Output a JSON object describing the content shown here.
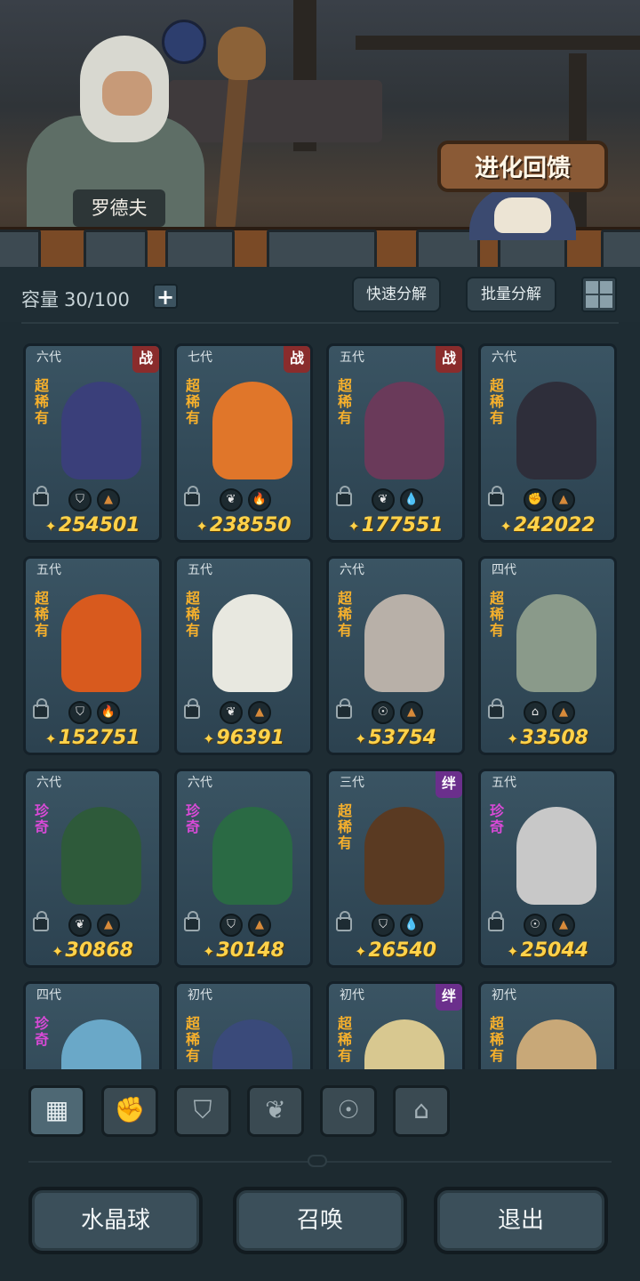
{
  "scene": {
    "npc_name": "罗德夫",
    "evolution_banner": "进化回馈"
  },
  "toolbar": {
    "capacity_label": "容量",
    "capacity_value": "30/100",
    "quick_decompose": "快速分解",
    "batch_decompose": "批量分解"
  },
  "cards": [
    {
      "gen": "六代",
      "tag": "战",
      "rarity": "超稀有",
      "power": "254501",
      "monster_color": "#3a3f7a",
      "badges": [
        "shield-icon",
        "earth-icon"
      ]
    },
    {
      "gen": "七代",
      "tag": "战",
      "rarity": "超稀有",
      "power": "238550",
      "monster_color": "#e0762a",
      "badges": [
        "leaf-icon",
        "fire-icon"
      ]
    },
    {
      "gen": "五代",
      "tag": "战",
      "rarity": "超稀有",
      "power": "177551",
      "monster_color": "#6a3a5a",
      "badges": [
        "leaf-icon",
        "water-icon"
      ]
    },
    {
      "gen": "六代",
      "tag": "",
      "rarity": "超稀有",
      "power": "242022",
      "monster_color": "#2e2e3a",
      "badges": [
        "claw-icon",
        "earth-icon"
      ]
    },
    {
      "gen": "五代",
      "tag": "",
      "rarity": "超稀有",
      "power": "152751",
      "monster_color": "#d85a1e",
      "badges": [
        "shield-icon",
        "fire-icon"
      ]
    },
    {
      "gen": "五代",
      "tag": "",
      "rarity": "超稀有",
      "power": "96391",
      "monster_color": "#e8e8e0",
      "badges": [
        "leaf-icon",
        "earth-icon"
      ]
    },
    {
      "gen": "六代",
      "tag": "",
      "rarity": "超稀有",
      "power": "53754",
      "monster_color": "#b8b0a8",
      "badges": [
        "spirit-icon",
        "earth-icon"
      ]
    },
    {
      "gen": "四代",
      "tag": "",
      "rarity": "超稀有",
      "power": "33508",
      "monster_color": "#8a9a8a",
      "badges": [
        "castle-icon",
        "earth-icon"
      ]
    },
    {
      "gen": "六代",
      "tag": "",
      "rarity": "珍奇",
      "power": "30868",
      "monster_color": "#2e5a3a",
      "badges": [
        "leaf-icon",
        "earth-icon"
      ]
    },
    {
      "gen": "六代",
      "tag": "",
      "rarity": "珍奇",
      "power": "30148",
      "monster_color": "#2a6a44",
      "badges": [
        "shield-icon",
        "earth-icon"
      ]
    },
    {
      "gen": "三代",
      "tag": "绊",
      "rarity": "超稀有",
      "power": "26540",
      "monster_color": "#5a3a22",
      "badges": [
        "shield-icon",
        "water-icon"
      ]
    },
    {
      "gen": "五代",
      "tag": "",
      "rarity": "珍奇",
      "power": "25044",
      "monster_color": "#c8c8c8",
      "badges": [
        "spirit-icon",
        "earth-icon"
      ]
    },
    {
      "gen": "四代",
      "tag": "",
      "rarity": "珍奇",
      "power": "",
      "monster_color": "#6aa8c8",
      "badges": []
    },
    {
      "gen": "初代",
      "tag": "",
      "rarity": "超稀有",
      "power": "",
      "monster_color": "#3a4a7a",
      "badges": []
    },
    {
      "gen": "初代",
      "tag": "绊",
      "rarity": "超稀有",
      "power": "",
      "monster_color": "#d8c890",
      "badges": []
    },
    {
      "gen": "初代",
      "tag": "",
      "rarity": "超稀有",
      "power": "",
      "monster_color": "#c8a878",
      "badges": []
    }
  ],
  "filters": [
    "all-icon",
    "claw-icon",
    "shield-icon",
    "leaf-icon",
    "spirit-icon",
    "castle-icon"
  ],
  "filter_glyphs": [
    "▦",
    "✊",
    "⛉",
    "❦",
    "☉",
    "⌂"
  ],
  "buttons": {
    "crystal_ball": "水晶球",
    "summon": "召唤",
    "exit": "退出"
  },
  "badge_glyphs": {
    "shield-icon": "⛉",
    "earth-icon": "▲",
    "leaf-icon": "❦",
    "fire-icon": "🔥",
    "water-icon": "💧",
    "claw-icon": "✊",
    "spirit-icon": "☉",
    "castle-icon": "⌂"
  },
  "badge_colors": {
    "shield-icon": "#e8e8e8",
    "earth-icon": "#d78a3a",
    "leaf-icon": "#e8e8e8",
    "fire-icon": "#e04030",
    "water-icon": "#5ec8e8",
    "claw-icon": "#e8e8e8",
    "spirit-icon": "#e8e8e8",
    "castle-icon": "#e8e8e8"
  }
}
